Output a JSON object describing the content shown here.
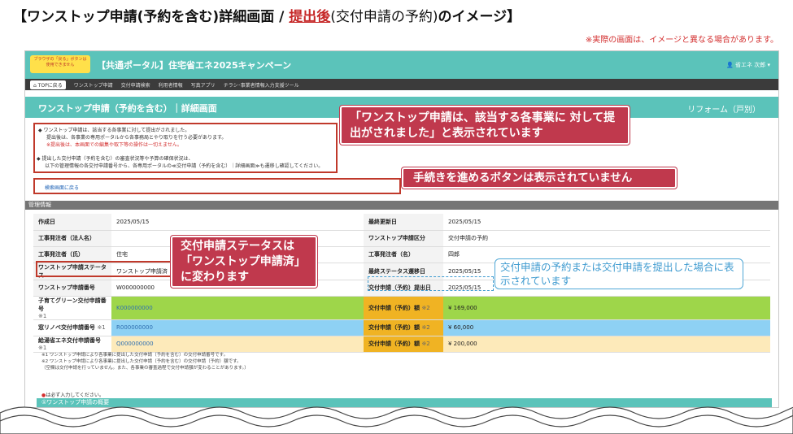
{
  "heading": {
    "prefix": "【ワンストップ申請(予約を含む)詳細画面 / ",
    "highlight": "提出後",
    "middle": "(交付申請の予約)",
    "suffix": "のイメージ】"
  },
  "disclaimer": "※実際の画面は、イメージと異なる場合があります。",
  "portal": {
    "notice_badge": "ブラウザの「戻る」ボタンは使用できません",
    "title": "【共通ポータル】住宅省エネ2025キャンペーン",
    "user": "省エネ 次郎"
  },
  "nav": {
    "home": "TOPに戻る",
    "items": [
      "ワンストップ申請",
      "交付申請検索",
      "利用者情報",
      "写真アプリ",
      "チラシ･事業者情報入力支援ツール"
    ]
  },
  "screen": {
    "title": "ワンストップ申請（予約を含む）｜詳細画面",
    "category": "リフォーム（戸別）"
  },
  "info": {
    "line1": "◆ ワンストップ申請は、該当する各事業に対して提出がされました。",
    "line2": "提出後は、各事業の専用ポータルから各事務局とやり取りを行う必要があります。",
    "line3": "※提出後は、本画面での編集や取下等の操作は一切えません。",
    "line4": "◆ 提出した交付申請（予約を含む）の審査状況等や予算の確保状況は、",
    "line5": "以下の管理情報の各交付申請番号から、各専用ポータルの≪交付申請（予約を含む）｜詳細画面≫も遷移し確認してください。"
  },
  "back_link": "検索画面に戻る",
  "section_title": "管理情報",
  "table": {
    "created_label": "作成日",
    "created": "2025/05/15",
    "updated_label": "最終更新日",
    "updated": "2025/05/15",
    "corp_label": "工事発注者（法人名）",
    "corp": "",
    "type_label": "ワンストップ申請区分",
    "type": "交付申請の予約",
    "last_label": "工事発注者（氏）",
    "last": "住宅",
    "first_label": "工事発注者（名）",
    "first": "四郎",
    "status_label": "ワンストップ申請ステータス",
    "status": "ワンストップ申請済",
    "status_date_label": "最終ステータス遷移日",
    "status_date": "2025/05/15",
    "no_label": "ワンストップ申請番号",
    "no": "W000000000",
    "submit_label": "交付申請（予約）提出日",
    "submit": "2025/05/15",
    "green_label": "子育てグリーン交付申請番号",
    "green_note": "※1",
    "green_no": "K000000000",
    "green_amt_label": "交付申請（予約）額",
    "green_amt_note": "※2",
    "green_amt": "¥ 169,000",
    "window_label": "窓リノベ交付申請番号",
    "window_note": "※1",
    "window_no": "R000000000",
    "window_amt_label": "交付申請（予約）額",
    "window_amt_note": "※2",
    "window_amt": "¥ 60,000",
    "heater_label": "給湯省エネ交付申請番号",
    "heater_note": "※1",
    "heater_no": "Q000000000",
    "heater_amt_label": "交付申請（予約）額",
    "heater_amt_note": "※2",
    "heater_amt": "¥ 200,000"
  },
  "footnotes": {
    "f1": "※1 ワンストップ申請により各事業に提出した交付申請（予約を含む）の交付申請番号です。",
    "f2": "※2 ワンストップ申請により各事業に提出した交付申請（予約を含む）の交付申請（予約）額です。",
    "f3": "（空欄は交付申請を行っていません。また、各事業の審査過程で交付申請額が変わることがあります。）"
  },
  "required_note": "は必ず入力してください。",
  "subsection": "①ワンストップ申請の概要",
  "callouts": {
    "submitted": "「ワンストップ申請は、該当する各事業に 対して提出がされました」と表示されています",
    "no_button": "手続きを進めるボタンは表示されていません",
    "status": "交付申請ステータスは 「ワンストップ申請済」 に変わります",
    "blue": "交付申請の予約または交付申請を提出した場合に表示されています"
  },
  "colors": {
    "teal": "#5bc3ba",
    "callout_red": "#c0394d",
    "green_row": "#9ed64a",
    "blue_row": "#8ed1f4",
    "yellow_row": "#fdeaba",
    "amount_label": "#f0b323"
  }
}
